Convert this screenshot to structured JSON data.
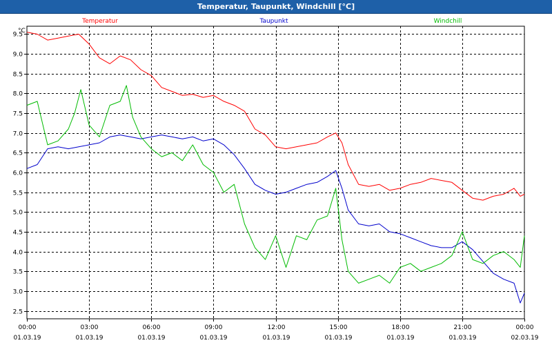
{
  "window": {
    "title": "Temperatur, Taupunkt, Windchill [°C]"
  },
  "chart_data": {
    "type": "line",
    "title": "Temperatur, Taupunkt, Windchill [°C]",
    "ylabel": "°C",
    "ylim": [
      2.3,
      9.7
    ],
    "yticks": [
      2.5,
      3.0,
      3.5,
      4.0,
      4.5,
      5.0,
      5.5,
      6.0,
      6.5,
      7.0,
      7.5,
      8.0,
      8.5,
      9.0,
      9.5
    ],
    "ytick_labels": [
      "2.5",
      "3.0",
      "3.5",
      "4.0",
      "4.5",
      "5.0",
      "5.5",
      "6.0",
      "6.5",
      "7.0",
      "7.5",
      "8.0",
      "8.5",
      "9.0",
      "9.5"
    ],
    "xlim": [
      0,
      24
    ],
    "xticks": [
      0,
      3,
      6,
      9,
      12,
      15,
      18,
      21,
      24
    ],
    "xtick_time_labels": [
      "00:00",
      "03:00",
      "06:00",
      "09:00",
      "12:00",
      "15:00",
      "18:00",
      "21:00",
      "00:00"
    ],
    "xtick_date_labels": [
      "01.03.19",
      "01.03.19",
      "01.03.19",
      "01.03.19",
      "01.03.19",
      "01.03.19",
      "01.03.19",
      "01.03.19",
      "02.03.19"
    ],
    "grid": true,
    "legend_placement": "top",
    "series": [
      {
        "name": "Temperatur",
        "color": "#ff0000",
        "x": [
          0,
          0.5,
          1,
          1.5,
          2,
          2.5,
          3,
          3.5,
          4,
          4.5,
          5,
          5.5,
          6,
          6.5,
          7,
          7.5,
          8,
          8.5,
          9,
          9.5,
          10,
          10.5,
          11,
          11.5,
          12,
          12.5,
          13,
          13.5,
          14,
          14.5,
          14.9,
          15.2,
          15.5,
          16,
          16.5,
          17,
          17.5,
          18,
          18.5,
          19,
          19.5,
          20,
          20.5,
          21,
          21.5,
          22,
          22.5,
          23,
          23.5,
          23.8,
          24
        ],
        "values": [
          9.55,
          9.5,
          9.35,
          9.4,
          9.45,
          9.5,
          9.25,
          8.9,
          8.75,
          8.95,
          8.85,
          8.6,
          8.45,
          8.15,
          8.05,
          7.95,
          7.98,
          7.9,
          7.95,
          7.8,
          7.7,
          7.55,
          7.1,
          6.95,
          6.65,
          6.6,
          6.65,
          6.7,
          6.75,
          6.9,
          7.0,
          6.75,
          6.2,
          5.7,
          5.65,
          5.7,
          5.55,
          5.6,
          5.7,
          5.75,
          5.85,
          5.8,
          5.75,
          5.55,
          5.35,
          5.3,
          5.4,
          5.45,
          5.6,
          5.4,
          5.45
        ]
      },
      {
        "name": "Taupunkt",
        "color": "#0000cc",
        "x": [
          0,
          0.5,
          1,
          1.5,
          2,
          2.5,
          3,
          3.5,
          4,
          4.5,
          5,
          5.5,
          6,
          6.5,
          7,
          7.5,
          8,
          8.5,
          9,
          9.5,
          10,
          10.5,
          11,
          11.5,
          12,
          12.5,
          13,
          13.5,
          14,
          14.5,
          14.9,
          15.2,
          15.5,
          16,
          16.5,
          17,
          17.5,
          18,
          18.5,
          19,
          19.5,
          20,
          20.5,
          21,
          21.5,
          22,
          22.5,
          23,
          23.5,
          23.8,
          24
        ],
        "values": [
          6.1,
          6.2,
          6.6,
          6.65,
          6.6,
          6.65,
          6.7,
          6.75,
          6.9,
          6.95,
          6.9,
          6.85,
          6.9,
          6.95,
          6.9,
          6.85,
          6.9,
          6.8,
          6.85,
          6.7,
          6.45,
          6.1,
          5.7,
          5.55,
          5.45,
          5.5,
          5.6,
          5.7,
          5.75,
          5.9,
          6.05,
          5.6,
          5.05,
          4.7,
          4.65,
          4.7,
          4.5,
          4.45,
          4.35,
          4.25,
          4.15,
          4.1,
          4.1,
          4.25,
          4.05,
          3.75,
          3.45,
          3.3,
          3.2,
          2.7,
          2.95
        ]
      },
      {
        "name": "Windchill",
        "color": "#00bb00",
        "x": [
          0,
          0.5,
          1,
          1.5,
          2,
          2.3,
          2.6,
          3,
          3.5,
          4,
          4.5,
          4.8,
          5.1,
          5.5,
          6,
          6.5,
          7,
          7.5,
          8,
          8.5,
          9,
          9.5,
          10,
          10.5,
          11,
          11.5,
          12,
          12.5,
          13,
          13.5,
          14,
          14.5,
          14.9,
          15.2,
          15.5,
          16,
          16.5,
          17,
          17.5,
          18,
          18.5,
          19,
          19.5,
          20,
          20.5,
          21,
          21.5,
          22,
          22.5,
          23,
          23.5,
          23.8,
          24
        ],
        "values": [
          7.7,
          7.8,
          6.7,
          6.8,
          7.1,
          7.5,
          8.1,
          7.2,
          6.9,
          7.7,
          7.8,
          8.2,
          7.4,
          6.9,
          6.6,
          6.4,
          6.5,
          6.3,
          6.7,
          6.2,
          6.0,
          5.5,
          5.7,
          4.7,
          4.1,
          3.8,
          4.4,
          3.6,
          4.4,
          4.3,
          4.8,
          4.9,
          5.6,
          4.3,
          3.5,
          3.2,
          3.3,
          3.4,
          3.2,
          3.6,
          3.7,
          3.5,
          3.6,
          3.7,
          3.9,
          4.5,
          3.8,
          3.7,
          3.9,
          4.0,
          3.8,
          3.6,
          4.4
        ]
      }
    ]
  }
}
